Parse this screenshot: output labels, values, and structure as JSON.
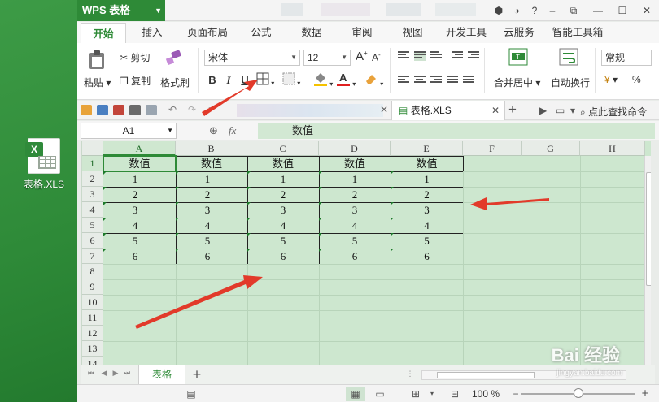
{
  "desktop": {
    "file_label": "表格.XLS",
    "badge": "X"
  },
  "titlebar": {
    "app_name": "WPS 表格"
  },
  "ribbon_tabs": [
    "开始",
    "插入",
    "页面布局",
    "公式",
    "数据",
    "审阅",
    "视图",
    "开发工具",
    "云服务",
    "智能工具箱"
  ],
  "ribbon": {
    "cut": "剪切",
    "copy": "复制",
    "paste": "粘贴",
    "format_painter": "格式刷",
    "font_name": "宋体",
    "font_size": "12",
    "bold": "B",
    "italic": "I",
    "underline": "U",
    "grow_font": "A",
    "shrink_font": "A",
    "merge_center": "合并居中",
    "wrap_text": "自动换行",
    "number_format": "常规",
    "percent": "%"
  },
  "doc_tab": {
    "name": "表格.XLS"
  },
  "search_command": "点此查找命令",
  "formula_bar": {
    "cell_ref": "A1",
    "fx": "fx",
    "content": "数值"
  },
  "columns": [
    "A",
    "B",
    "C",
    "D",
    "E",
    "F",
    "G",
    "H"
  ],
  "rows": [
    "1",
    "2",
    "3",
    "4",
    "5",
    "6",
    "7",
    "8",
    "9",
    "10",
    "11",
    "12",
    "13",
    "14"
  ],
  "table": {
    "header": [
      "数值",
      "数值",
      "数值",
      "数值",
      "数值"
    ],
    "values": [
      [
        "1",
        "1",
        "1",
        "1",
        "1"
      ],
      [
        "2",
        "2",
        "2",
        "2",
        "2"
      ],
      [
        "3",
        "3",
        "3",
        "3",
        "3"
      ],
      [
        "4",
        "4",
        "4",
        "4",
        "4"
      ],
      [
        "5",
        "5",
        "5",
        "5",
        "5"
      ],
      [
        "6",
        "6",
        "6",
        "6",
        "6"
      ]
    ]
  },
  "sheet_tabs": {
    "active": "表格",
    "add": "+"
  },
  "status": {
    "zoom": "100 %"
  },
  "watermark": {
    "main": "Bai 经验",
    "sub": "jingyan.baidu.com"
  }
}
